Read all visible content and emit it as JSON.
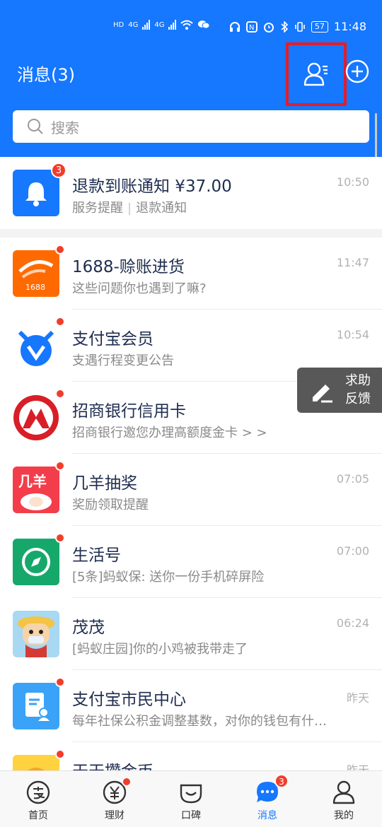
{
  "status_bar": {
    "time": "11:48",
    "battery": "57",
    "network_left": "HD",
    "network_right": "HD",
    "lte1": "4G",
    "lte2": "4G"
  },
  "header": {
    "title": "消息(3)",
    "contacts_icon": "contacts-icon",
    "add_icon": "plus-circle-icon",
    "highlight_color": "#e11d2b",
    "bg_color": "#1677ff"
  },
  "search": {
    "placeholder": "搜索"
  },
  "pinned": {
    "name": "退款到账通知 ¥37.00",
    "desc_a": "服务提醒",
    "desc_b": "退款通知",
    "time": "10:50",
    "badge": "3",
    "icon": "bell-icon"
  },
  "messages": [
    {
      "name": "1688-赊账进货",
      "desc": "这些问题你也遇到了嘛?",
      "time": "11:47",
      "icon": "1688-logo",
      "brand": "1688"
    },
    {
      "name": "支付宝会员",
      "desc": "支遇行程变更公告",
      "time": "10:54",
      "icon": "member-icon"
    },
    {
      "name": "招商银行信用卡",
      "desc": "招商银行邀您办理高额度金卡 > >",
      "time": "",
      "icon": "cmb-logo"
    },
    {
      "name": "几羊抽奖",
      "desc": "奖励领取提醒",
      "time": "07:05",
      "icon": "sheep-logo",
      "brand": "几羊"
    },
    {
      "name": "生活号",
      "desc": "[5条]蚂蚁保: 送你一份手机碎屏险",
      "time": "07:00",
      "icon": "compass-icon"
    },
    {
      "name": "茂茂",
      "desc": "[蚂蚁庄园]你的小鸡被我带走了",
      "time": "06:24",
      "icon": "user-avatar"
    },
    {
      "name": "支付宝市民中心",
      "desc": "每年社保公积金调整基数，对你的钱包有什…",
      "time": "昨天",
      "icon": "document-icon"
    },
    {
      "name": "天天攒金币",
      "desc": "",
      "time": "昨天",
      "icon": "coin-icon"
    }
  ],
  "float_feedback": {
    "line1": "求助",
    "line2": "反馈",
    "icon": "edit-icon"
  },
  "tabbar": [
    {
      "label": "首页",
      "icon": "alipay-icon",
      "active": false
    },
    {
      "label": "理财",
      "icon": "yen-icon",
      "active": false,
      "dot": true
    },
    {
      "label": "口碑",
      "icon": "koubei-icon",
      "active": false
    },
    {
      "label": "消息",
      "icon": "chat-icon",
      "active": true,
      "badge": "3"
    },
    {
      "label": "我的",
      "icon": "person-icon",
      "active": false
    }
  ]
}
